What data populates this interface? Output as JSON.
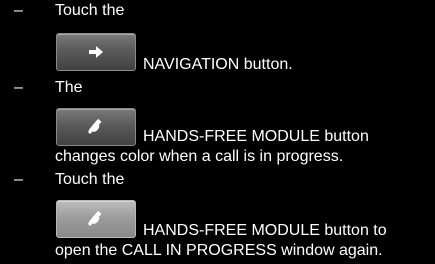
{
  "instructions": [
    {
      "bullet": "–",
      "intro": "Touch the",
      "button_icon": "arrow-right-icon",
      "after_button": "NAVIGATION button."
    },
    {
      "bullet": "–",
      "intro": "The",
      "button_icon": "phone-handset-icon",
      "after_button": "HANDS-FREE MODULE button",
      "continuation": "changes color when a call is in progress."
    },
    {
      "bullet": "–",
      "intro": "Touch the",
      "button_icon": "phone-handset-icon",
      "after_button": "HANDS-FREE MODULE button to",
      "continuation": "open the CALL IN PROGRESS window again."
    }
  ],
  "colors": {
    "background": "#000000",
    "text": "#ffffff",
    "button_normal": "#5a5a5a",
    "button_active": "#9c9c9c"
  }
}
